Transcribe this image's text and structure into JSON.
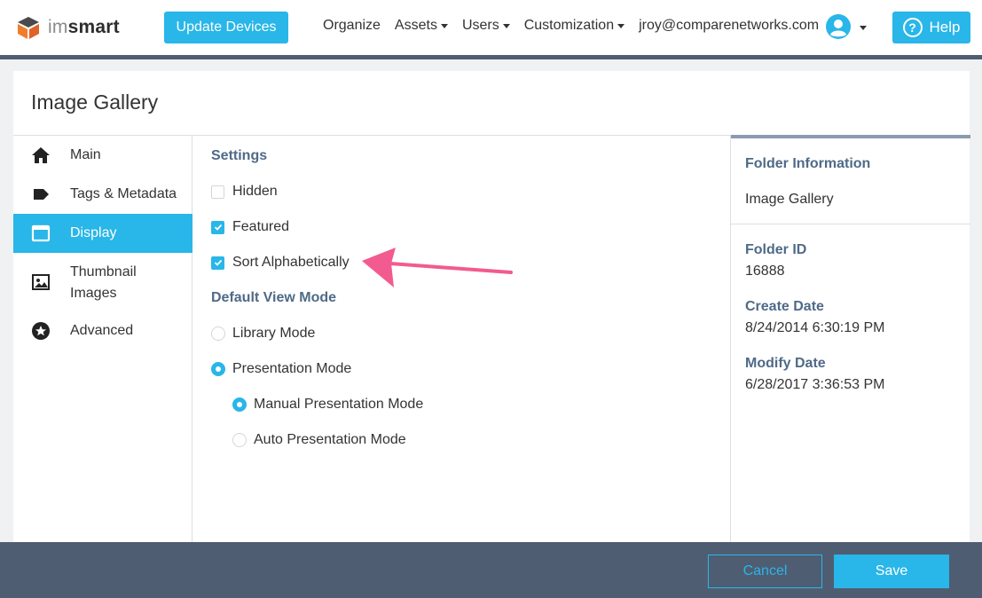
{
  "header": {
    "logo_light": "im",
    "logo_bold": "smart",
    "update_button": "Update Devices",
    "nav": [
      {
        "label": "Organize",
        "has_caret": false
      },
      {
        "label": "Assets",
        "has_caret": true
      },
      {
        "label": "Users",
        "has_caret": true
      },
      {
        "label": "Customization",
        "has_caret": true
      },
      {
        "label": "jroy@comparenetworks.com",
        "has_caret": false
      }
    ],
    "help_label": "Help",
    "help_glyph": "?"
  },
  "panel": {
    "title": "Image Gallery"
  },
  "sidebar": {
    "items": [
      {
        "label": "Main",
        "icon": "home-icon"
      },
      {
        "label": "Tags & Metadata",
        "icon": "tag-icon"
      },
      {
        "label": "Display",
        "icon": "window-icon",
        "active": true
      },
      {
        "label": "Thumbnail",
        "label2": "Images",
        "icon": "image-icon"
      },
      {
        "label": "Advanced",
        "icon": "star-icon"
      }
    ]
  },
  "settings": {
    "heading": "Settings",
    "hidden_label": "Hidden",
    "hidden_checked": false,
    "featured_label": "Featured",
    "featured_checked": true,
    "sort_label": "Sort Alphabetically",
    "sort_checked": true,
    "view_mode_heading": "Default View Mode",
    "library_label": "Library Mode",
    "presentation_label": "Presentation Mode",
    "manual_label": "Manual Presentation Mode",
    "auto_label": "Auto Presentation Mode",
    "selected_view_mode": "Presentation Mode",
    "selected_presentation_mode": "Manual Presentation Mode"
  },
  "info": {
    "folder_info_heading": "Folder Information",
    "folder_name": "Image Gallery",
    "folder_id_heading": "Folder ID",
    "folder_id": "16888",
    "create_date_heading": "Create Date",
    "create_date": "8/24/2014 6:30:19 PM",
    "modify_date_heading": "Modify Date",
    "modify_date": "6/28/2017 3:36:53 PM"
  },
  "footer": {
    "cancel_label": "Cancel",
    "save_label": "Save"
  },
  "colors": {
    "accent": "#29b6e8",
    "navy": "#4f5d73",
    "heading_blue": "#4f6a87",
    "annotation_pink": "#f25b8f"
  }
}
